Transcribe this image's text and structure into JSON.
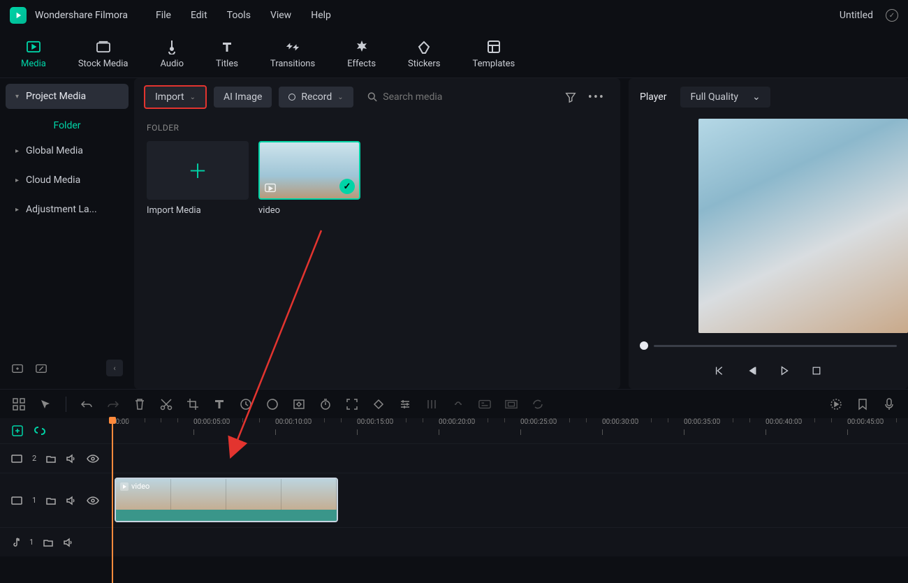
{
  "app": {
    "name": "Wondershare Filmora",
    "doc_title": "Untitled"
  },
  "menubar": [
    "File",
    "Edit",
    "Tools",
    "View",
    "Help"
  ],
  "tabs": [
    {
      "label": "Media",
      "active": true
    },
    {
      "label": "Stock Media"
    },
    {
      "label": "Audio"
    },
    {
      "label": "Titles"
    },
    {
      "label": "Transitions"
    },
    {
      "label": "Effects"
    },
    {
      "label": "Stickers"
    },
    {
      "label": "Templates"
    }
  ],
  "sidebar": {
    "project_media": "Project Media",
    "folder": "Folder",
    "global_media": "Global Media",
    "cloud_media": "Cloud Media",
    "adjustment": "Adjustment La..."
  },
  "media_toolbar": {
    "import": "Import",
    "ai_image": "AI Image",
    "record": "Record",
    "search_placeholder": "Search media"
  },
  "media_body": {
    "folder_label": "FOLDER",
    "import_card": "Import Media",
    "video_card": "video"
  },
  "player": {
    "title": "Player",
    "quality": "Full Quality"
  },
  "timeline": {
    "ruler": [
      "00:00",
      "00:00:05:00",
      "00:00:10:00",
      "00:00:15:00",
      "00:00:20:00",
      "00:00:25:00",
      "00:00:30:00",
      "00:00:35:00",
      "00:00:40:00",
      "00:00:45:00"
    ],
    "track2_label": "2",
    "track1_label": "1",
    "audiotrack_label": "1",
    "clip_name": "video"
  }
}
